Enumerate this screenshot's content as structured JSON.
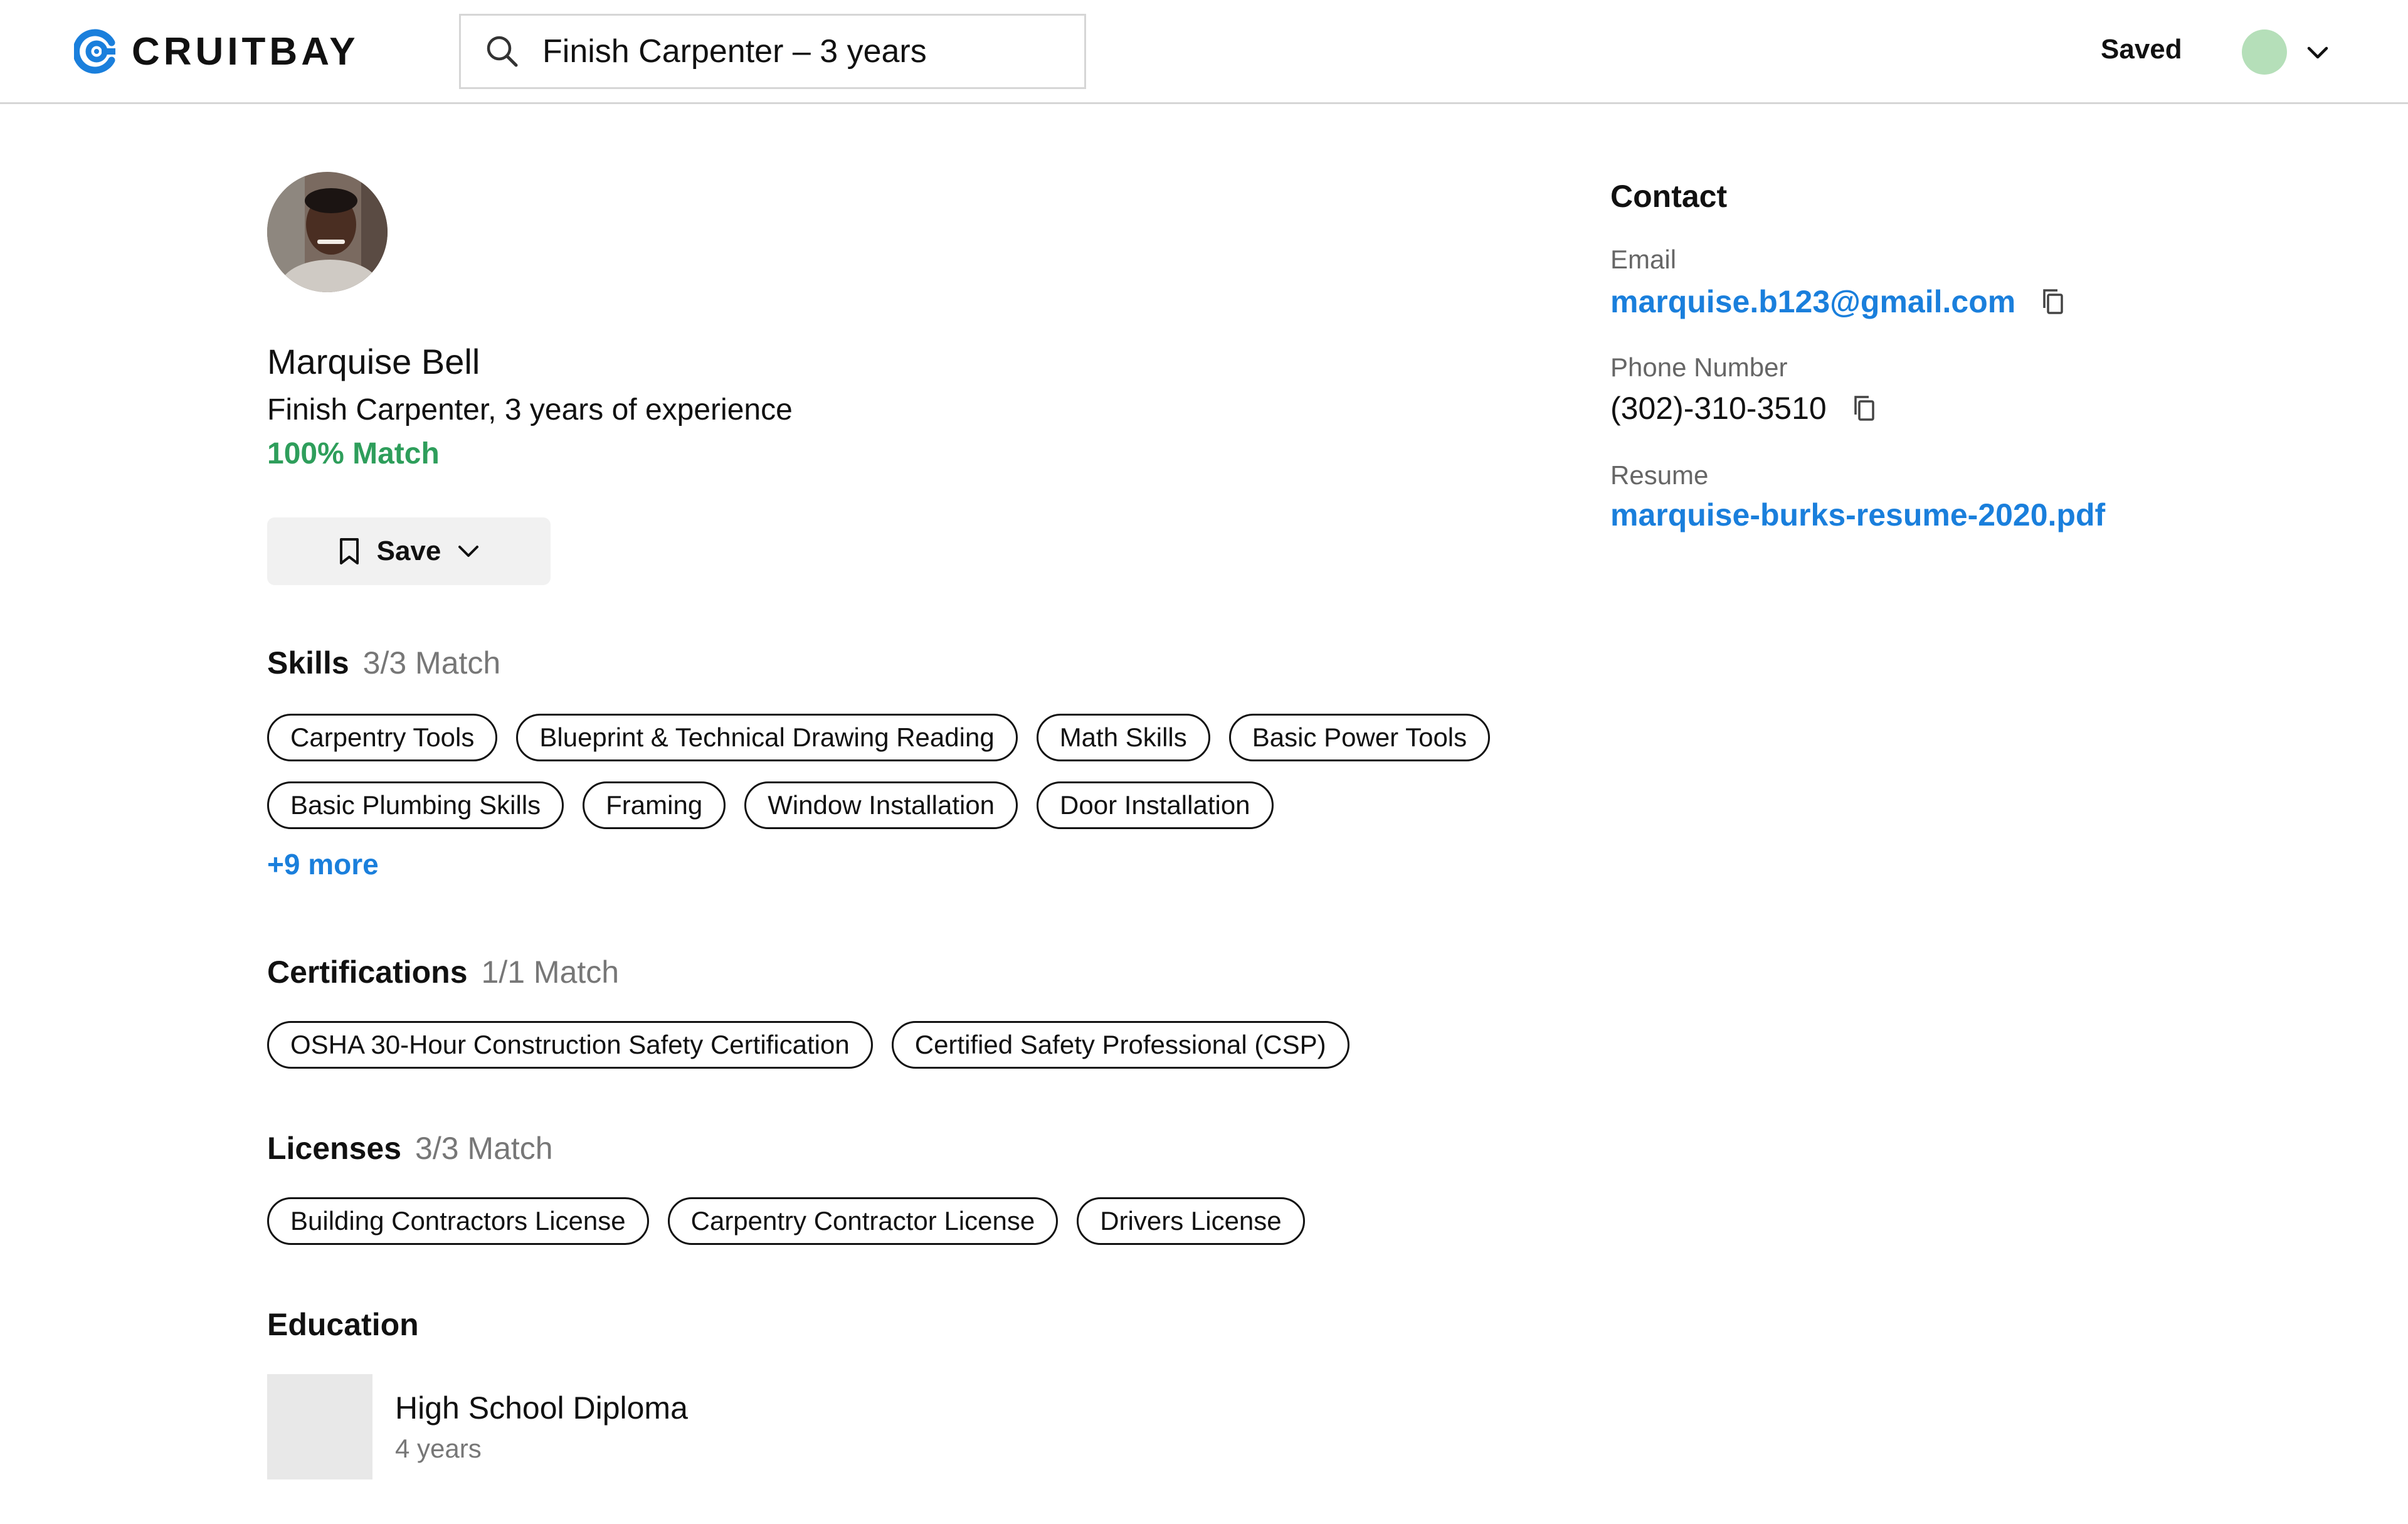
{
  "header": {
    "brand": "CRUITBAY",
    "search_value": "Finish Carpenter – 3 years",
    "saved_label": "Saved"
  },
  "profile": {
    "name": "Marquise Bell",
    "role": "Finish Carpenter, 3 years of experience",
    "match": "100% Match",
    "save_label": "Save"
  },
  "skills": {
    "title": "Skills",
    "match": "3/3 Match",
    "items": [
      "Carpentry Tools",
      "Blueprint & Technical Drawing Reading",
      "Math Skills",
      "Basic Power Tools",
      "Basic Plumbing Skills",
      "Framing",
      "Window Installation",
      "Door Installation"
    ],
    "more": "+9 more"
  },
  "certifications": {
    "title": "Certifications",
    "match": "1/1 Match",
    "items": [
      "OSHA 30-Hour Construction Safety Certification",
      "Certified Safety Professional (CSP)"
    ]
  },
  "licenses": {
    "title": "Licenses",
    "match": "3/3 Match",
    "items": [
      "Building Contractors License",
      "Carpentry Contractor License",
      "Drivers License"
    ]
  },
  "education": {
    "title": "Education",
    "entries": [
      {
        "degree": "High School Diploma",
        "duration": "4 years"
      }
    ]
  },
  "contact": {
    "title": "Contact",
    "email_label": "Email",
    "email": "marquise.b123@gmail.com",
    "phone_label": "Phone Number",
    "phone": "(302)-310-3510",
    "resume_label": "Resume",
    "resume": "marquise-burks-resume-2020.pdf"
  },
  "colors": {
    "accent": "#1a7fdc",
    "match_green": "#2e9e5b",
    "avatar_placeholder": "#b5dfb9",
    "muted": "#777777"
  },
  "icons": [
    "logo-icon",
    "search-icon",
    "chevron-down-icon",
    "bookmark-icon",
    "copy-icon"
  ]
}
